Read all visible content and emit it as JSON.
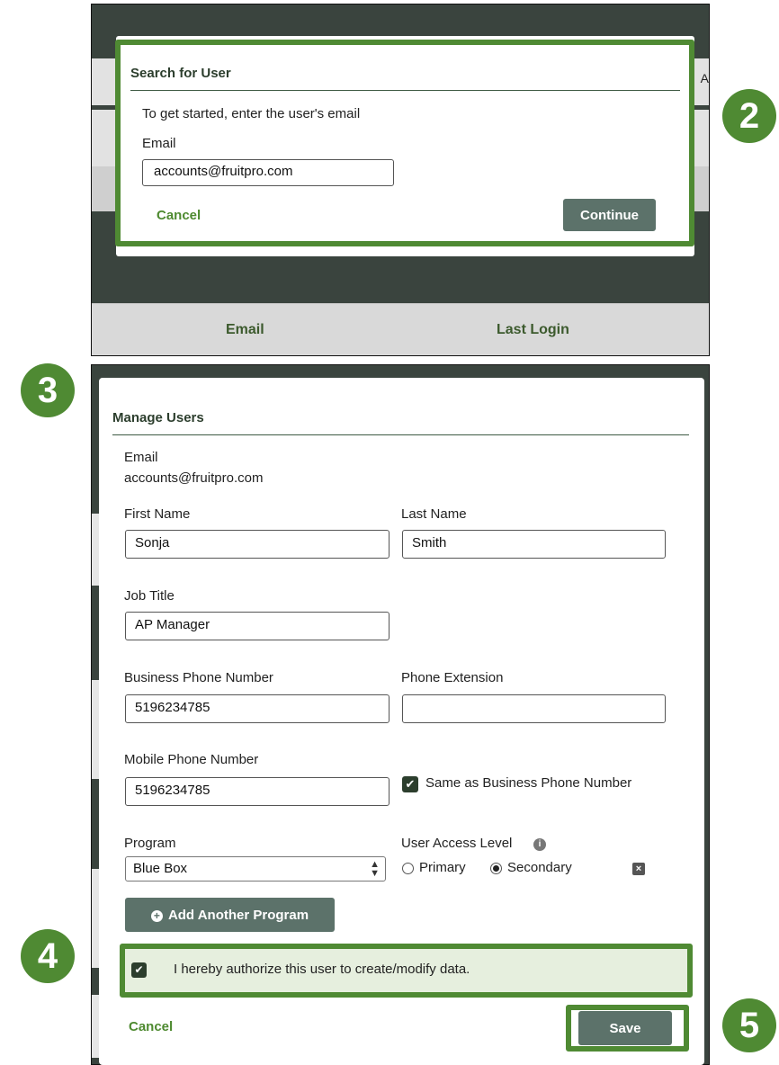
{
  "steps": [
    "2",
    "3",
    "4",
    "5"
  ],
  "background_table": {
    "columns": [
      "Email",
      "Last Login"
    ],
    "edge_text": "A"
  },
  "search_dialog": {
    "title": "Search for User",
    "intro": "To get started, enter the user's email",
    "email_label": "Email",
    "email_value": "accounts@fruitpro.com",
    "cancel_label": "Cancel",
    "continue_label": "Continue"
  },
  "manage_dialog": {
    "title": "Manage Users",
    "email_label": "Email",
    "email_value": "accounts@fruitpro.com",
    "first_name_label": "First Name",
    "first_name_value": "Sonja",
    "last_name_label": "Last Name",
    "last_name_value": "Smith",
    "job_title_label": "Job Title",
    "job_title_value": "AP Manager",
    "business_phone_label": "Business Phone Number",
    "business_phone_value": "5196234785",
    "phone_extension_label": "Phone Extension",
    "phone_extension_value": "",
    "mobile_phone_label": "Mobile Phone Number",
    "mobile_phone_value": "5196234785",
    "same_as_business_label": "Same as Business Phone Number",
    "same_as_business_checked": true,
    "program_label": "Program",
    "program_value": "Blue Box",
    "access_level_label": "User Access Level",
    "access_primary_label": "Primary",
    "access_secondary_label": "Secondary",
    "access_selected": "Secondary",
    "add_program_label": "Add Another Program",
    "authorize_label": "I hereby authorize this user to create/modify data.",
    "authorize_checked": true,
    "cancel_label": "Cancel",
    "save_label": "Save"
  },
  "colors": {
    "accent_green": "#4f8a33",
    "button_gray_green": "#5c726a",
    "overlay_dark": "#3a443e"
  }
}
